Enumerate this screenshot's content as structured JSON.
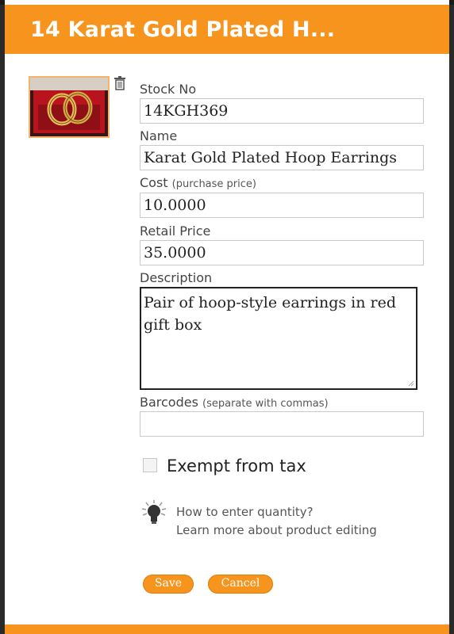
{
  "header": {
    "title": "14 Karat Gold Plated H..."
  },
  "product_image": {
    "icon": "product-photo"
  },
  "form": {
    "stock_no": {
      "label": "Stock No",
      "value": "14KGH369"
    },
    "name": {
      "label": "Name",
      "value": "Karat Gold Plated Hoop Earrings"
    },
    "cost": {
      "label": "Cost",
      "hint": "(purchase price)",
      "value": "10.0000"
    },
    "retail_price": {
      "label": "Retail Price",
      "value": "35.0000"
    },
    "description": {
      "label": "Description",
      "value": "Pair of hoop-style earrings in red gift box"
    },
    "barcodes": {
      "label": "Barcodes",
      "hint": "(separate with commas)",
      "value": ""
    },
    "exempt_tax": {
      "label": "Exempt from tax",
      "checked": false
    }
  },
  "help": {
    "quantity_link": "How to enter quantity?",
    "editing_link": "Learn more about product editing"
  },
  "actions": {
    "save": "Save",
    "cancel": "Cancel"
  },
  "colors": {
    "accent": "#f7941d",
    "header_text": "#ffffff"
  }
}
